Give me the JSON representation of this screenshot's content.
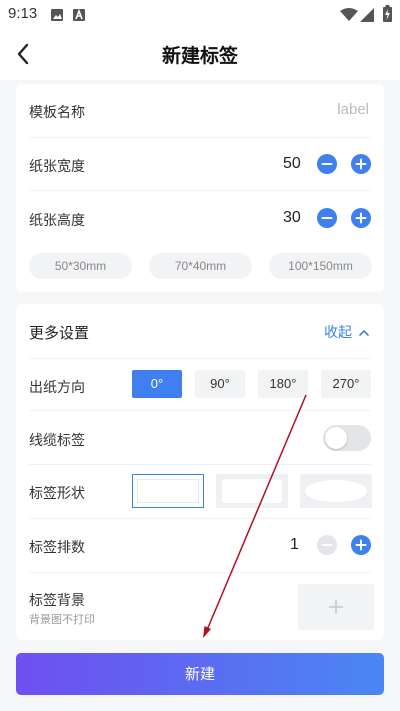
{
  "status_bar": {
    "time": "9:13",
    "icons": [
      "image-icon",
      "a-icon",
      "wifi-icon",
      "signal-icon",
      "battery-charging-icon"
    ]
  },
  "header": {
    "title": "新建标签",
    "back_icon": "chevron-left-icon"
  },
  "basic": {
    "template_name_label": "模板名称",
    "template_name_value": "label",
    "width_label": "纸张宽度",
    "width_value": "50",
    "height_label": "纸张高度",
    "height_value": "30",
    "presets": [
      "50*30mm",
      "70*40mm",
      "100*150mm"
    ]
  },
  "more": {
    "title": "更多设置",
    "collapse_label": "收起",
    "direction_label": "出纸方向",
    "directions": [
      "0°",
      "90°",
      "180°",
      "270°"
    ],
    "selected_direction": "0°",
    "cable_label": "线缆标签",
    "cable_enabled": false,
    "shape_label": "标签形状",
    "shapes": [
      "rectangle",
      "rounded-rectangle",
      "ellipse"
    ],
    "selected_shape": "rectangle",
    "rows_label": "标签排数",
    "rows_value": "1",
    "background_label": "标签背景",
    "background_hint": "背景图不打印"
  },
  "footer": {
    "create_label": "新建"
  },
  "colors": {
    "accent": "#3f7ff0",
    "gradient_start": "#6e4ff0",
    "gradient_end": "#4a87f2",
    "annotation_arrow": "#b01020"
  }
}
